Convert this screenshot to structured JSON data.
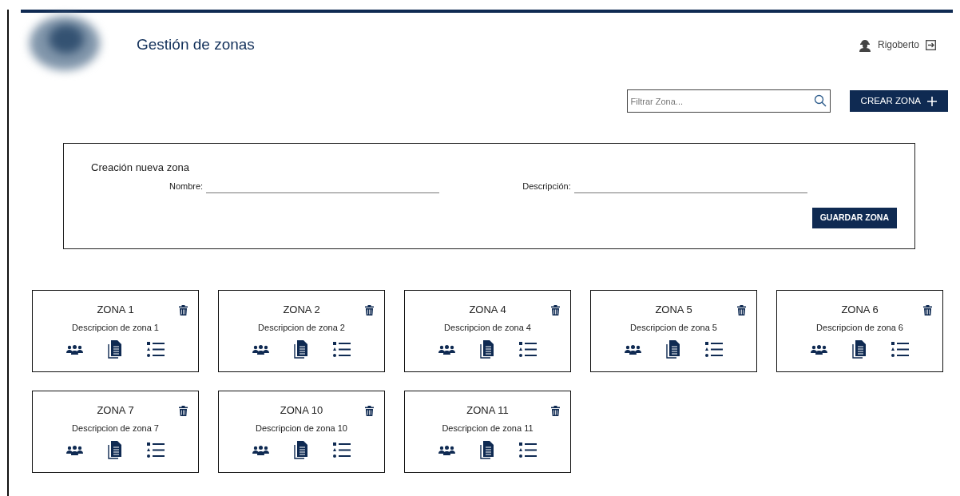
{
  "header": {
    "title": "Gestión de zonas",
    "user": "Rigoberto"
  },
  "toolbar": {
    "filter": {
      "placeholder": "Filtrar Zona..."
    },
    "create_button": "CREAR ZONA"
  },
  "new_zone_form": {
    "title": "Creación nueva zona",
    "fields": [
      {
        "label": "Nombre:"
      },
      {
        "label": "Descripción:"
      }
    ],
    "save_button": "GUARDAR ZONA"
  },
  "zones": [
    {
      "name": "ZONA 1",
      "description": "Descripcion de zona 1"
    },
    {
      "name": "ZONA 2",
      "description": "Descripcion de zona 2"
    },
    {
      "name": "ZONA 4",
      "description": "Descripcion de zona 4"
    },
    {
      "name": "ZONA 5",
      "description": "Descripcion de zona 5"
    },
    {
      "name": "ZONA 6",
      "description": "Descripcion de zona 6"
    },
    {
      "name": "ZONA 7",
      "description": "Descripcion de zona 7"
    },
    {
      "name": "ZONA 10",
      "description": "Descripcion de zona 10"
    },
    {
      "name": "ZONA 11",
      "description": "Descripcion de zona 11"
    }
  ]
}
